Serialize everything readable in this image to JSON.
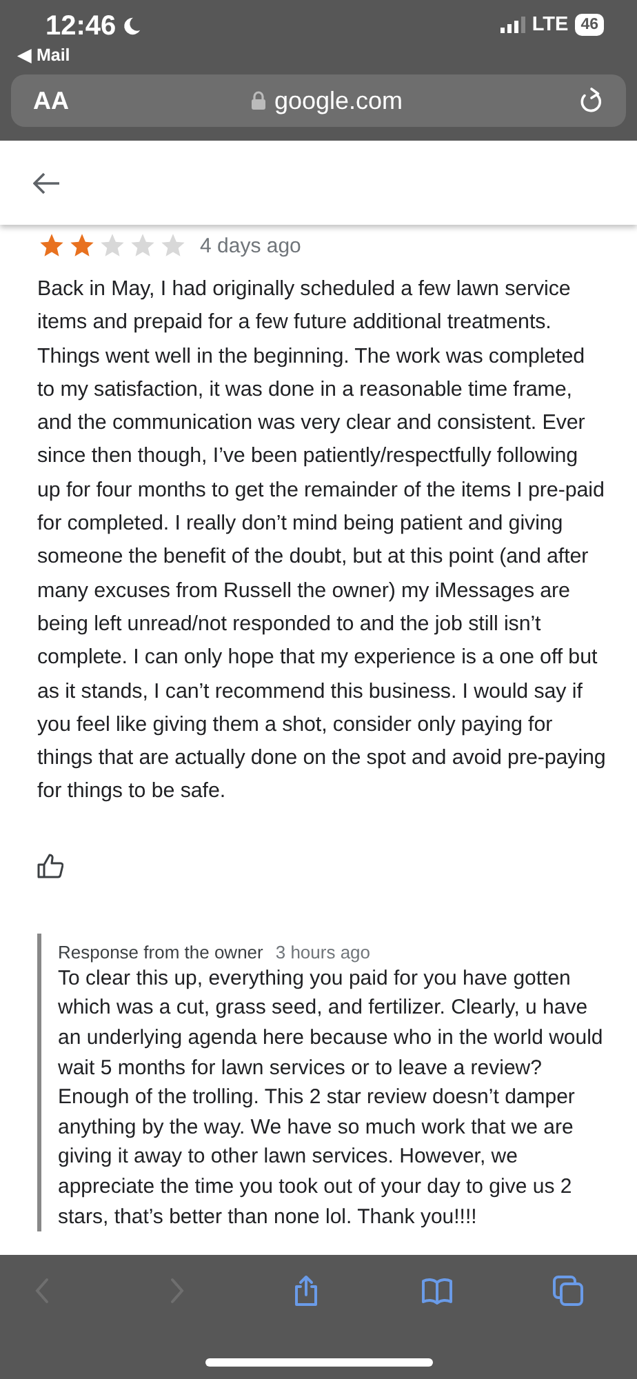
{
  "status_bar": {
    "time": "12:46",
    "back_app": "◀ Mail",
    "network": "LTE",
    "battery": "46"
  },
  "address_bar": {
    "text_size": "AA",
    "domain": "google.com"
  },
  "review": {
    "stars": 2,
    "time": "4 days ago",
    "text": "Back in May, I had originally scheduled a few lawn service items and prepaid for a few future additional treatments. Things went well in the beginning. The work was completed to my satisfaction, it was done in a reasonable time frame, and the communication was very clear and consistent. Ever since then though, I’ve been patiently/respectfully following up for four months to get the remainder of the items I pre-paid for completed. I really don’t mind being patient and giving someone the benefit of the doubt, but at this point (and after many excuses from Russell the owner) my iMessages are being left unread/not responded to and the job still isn’t complete. I can only hope that my experience is a one off but as it stands, I can’t recommend this business. I would say if you feel like giving them a shot, consider only paying for things that are actually done on the spot and avoid pre-paying for things to be safe."
  },
  "owner_response": {
    "label": "Response from the owner",
    "time": "3 hours ago",
    "text": "To clear this up, everything you paid for you have gotten which was a cut, grass seed, and fertilizer. Clearly, u have an underlying agenda here because who in the world would wait 5 months for lawn services or to leave a review? Enough of the trolling. This 2 star review doesn’t damper anything by the way. We have so much work that we are giving it away to other lawn services. However, we appreciate the time you took out of your day to give us 2 stars, that’s better than none lol. Thank you!!!!"
  },
  "toolbar": [
    {
      "kind": "back",
      "disabled": true
    },
    {
      "kind": "forward",
      "disabled": true
    },
    {
      "kind": "share",
      "disabled": false
    },
    {
      "kind": "bookmarks",
      "disabled": false
    },
    {
      "kind": "tabs",
      "disabled": false
    }
  ]
}
